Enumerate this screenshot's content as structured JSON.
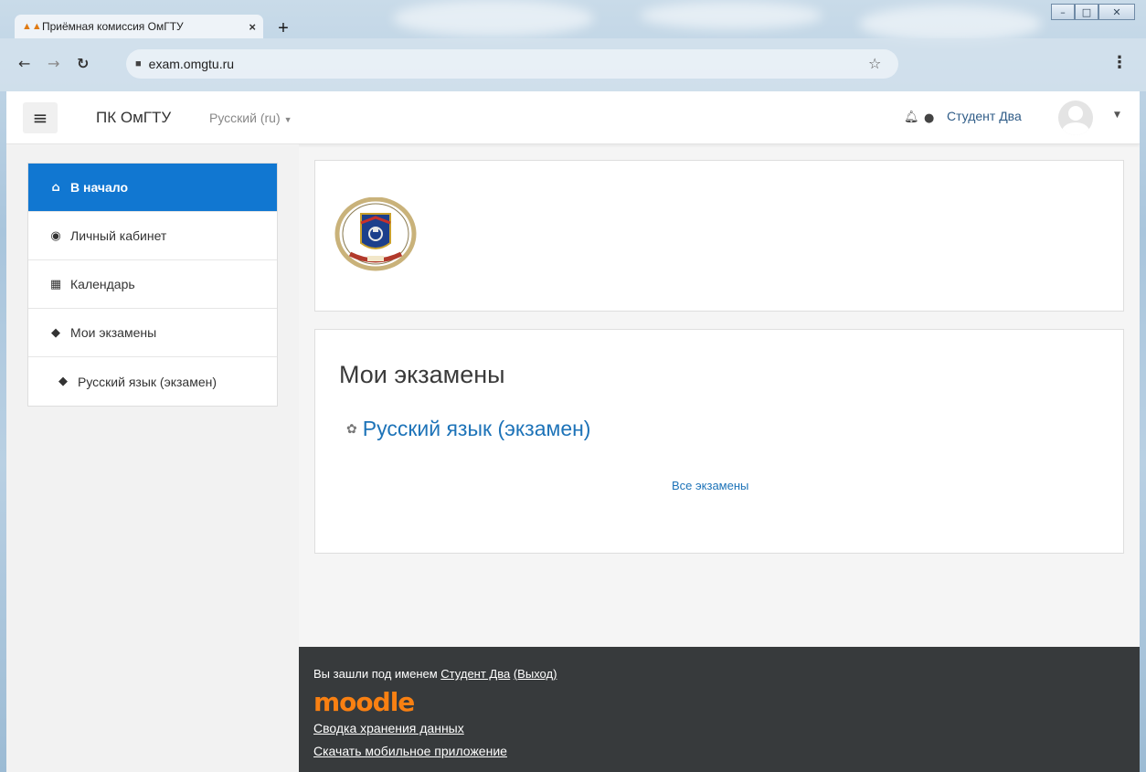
{
  "browser": {
    "tab_title": "Приёмная комиссия ОмГТУ",
    "tab_close": "×",
    "new_tab": "+",
    "url": "exam.omgtu.ru",
    "caption": {
      "minimize": "–",
      "maximize": "□",
      "close": "✕"
    }
  },
  "navbar": {
    "site_name": "ПК ОмГТУ",
    "language": "Русский (ru)",
    "user_name": "Студент Два"
  },
  "drawer": {
    "items": [
      {
        "label": "В начало",
        "icon": "home-icon",
        "active": true
      },
      {
        "label": "Личный кабинет",
        "icon": "dashboard-icon",
        "active": false
      },
      {
        "label": "Календарь",
        "icon": "calendar-icon",
        "active": false
      },
      {
        "label": "Мои экзамены",
        "icon": "graduation-cap-icon",
        "active": false
      },
      {
        "label": "Русский язык (экзамен)",
        "icon": "graduation-cap-icon",
        "active": false
      }
    ]
  },
  "exams_block": {
    "title": "Мои экзамены",
    "course": "Русский язык (экзамен)",
    "all_link": "Все экзамены"
  },
  "footer": {
    "login_prefix": "Вы зашли под именем",
    "user_link": "Студент Два",
    "logout_link": "(Выход)",
    "moodle": "moodle",
    "data_retention": "Сводка хранения данных",
    "mobile_app": "Скачать мобильное приложение"
  },
  "colors": {
    "accent": "#1177d1",
    "link": "#1d73b8",
    "footer_bg": "#373a3c",
    "moodle_orange": "#f98012"
  }
}
